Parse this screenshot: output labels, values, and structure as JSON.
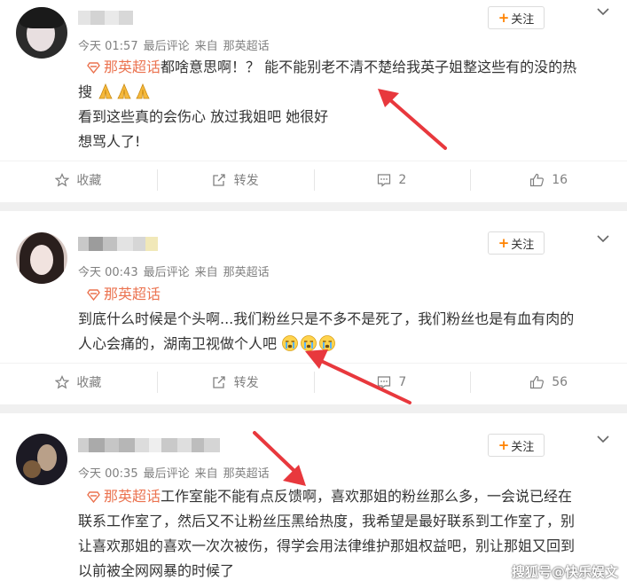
{
  "follow_label": "关注",
  "topic_label": "那英超话",
  "posts": [
    {
      "time": "今天 01:57",
      "activity": "最后评论",
      "source_prefix": "来自",
      "source": "那英超话",
      "content_lines": [
        "都啥意思啊！？ 能不能别老不清不楚给我英子姐整这些有的没的热",
        "搜",
        "看到这些真的会伤心 放过我姐吧 她很好",
        "想骂人了!"
      ],
      "emoji": "pray-emoji",
      "actions": {
        "favorite": "收藏",
        "repost": "转发",
        "comments": "2",
        "likes": "16"
      }
    },
    {
      "time": "今天 00:43",
      "activity": "最后评论",
      "source_prefix": "来自",
      "source": "那英超话",
      "content_lines": [
        "到底什么时候是个头啊...我们粉丝只是不多不是死了，我们粉丝也是有血有肉的",
        "人心会痛的，湖南卫视做个人吧"
      ],
      "emoji": "crying-emoji",
      "actions": {
        "favorite": "收藏",
        "repost": "转发",
        "comments": "7",
        "likes": "56"
      }
    },
    {
      "time": "今天 00:35",
      "activity": "最后评论",
      "source_prefix": "来自",
      "source": "那英超话",
      "content_lines": [
        "工作室能不能有点反馈啊，喜欢那姐的粉丝那么多，一会说已经在",
        "联系工作室了，然后又不让粉丝压黑给热度，我希望是最好联系到工作室了，别",
        "让喜欢那姐的喜欢一次次被伤，得学会用法律维护那姐权益吧，别让那姐又回到",
        "以前被全网网暴的时候了"
      ]
    }
  ],
  "watermark": "搜狐号@快乐娱文",
  "colors": {
    "accent": "#ff8200",
    "topic": "#eb7350",
    "arrow": "#e8383d"
  }
}
